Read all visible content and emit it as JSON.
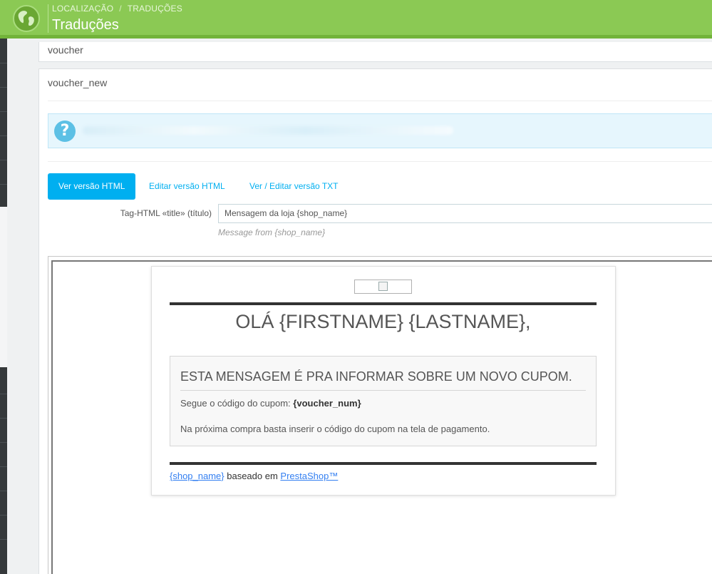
{
  "header": {
    "breadcrumb": [
      "LOCALIZAÇÃO",
      "TRADUÇÕES"
    ],
    "title": "Traduções",
    "icon": "globe-icon",
    "color": "#8bc954"
  },
  "panels": {
    "collapsed_template": "voucher",
    "open_template": "voucher_new"
  },
  "tabs": [
    {
      "label": "Ver versão HTML",
      "active": true
    },
    {
      "label": "Editar versão HTML",
      "active": false
    },
    {
      "label": "Ver / Editar versão TXT",
      "active": false
    }
  ],
  "form": {
    "title_label": "Tag-HTML «title» (título)",
    "title_value": "Mensagem da loja {shop_name}",
    "title_help": "Message from {shop_name}"
  },
  "email": {
    "greeting": "OLÁ {FIRSTNAME} {LASTNAME},",
    "message_title": "ESTA MENSAGEM É PRA INFORMAR SOBRE UM NOVO CUPOM.",
    "code_prefix": "Segue o código do cupom:",
    "code_value": "{voucher_num}",
    "instructions": "Na próxima compra basta inserir o código do cupom na tela de pagamento.",
    "footer_shop": "{shop_name}",
    "footer_middle": " baseado em ",
    "footer_brand": "PrestaShop™"
  },
  "colors": {
    "accent": "#00aff0",
    "link": "#337ff1",
    "alert_bg": "#e6f6fd"
  }
}
